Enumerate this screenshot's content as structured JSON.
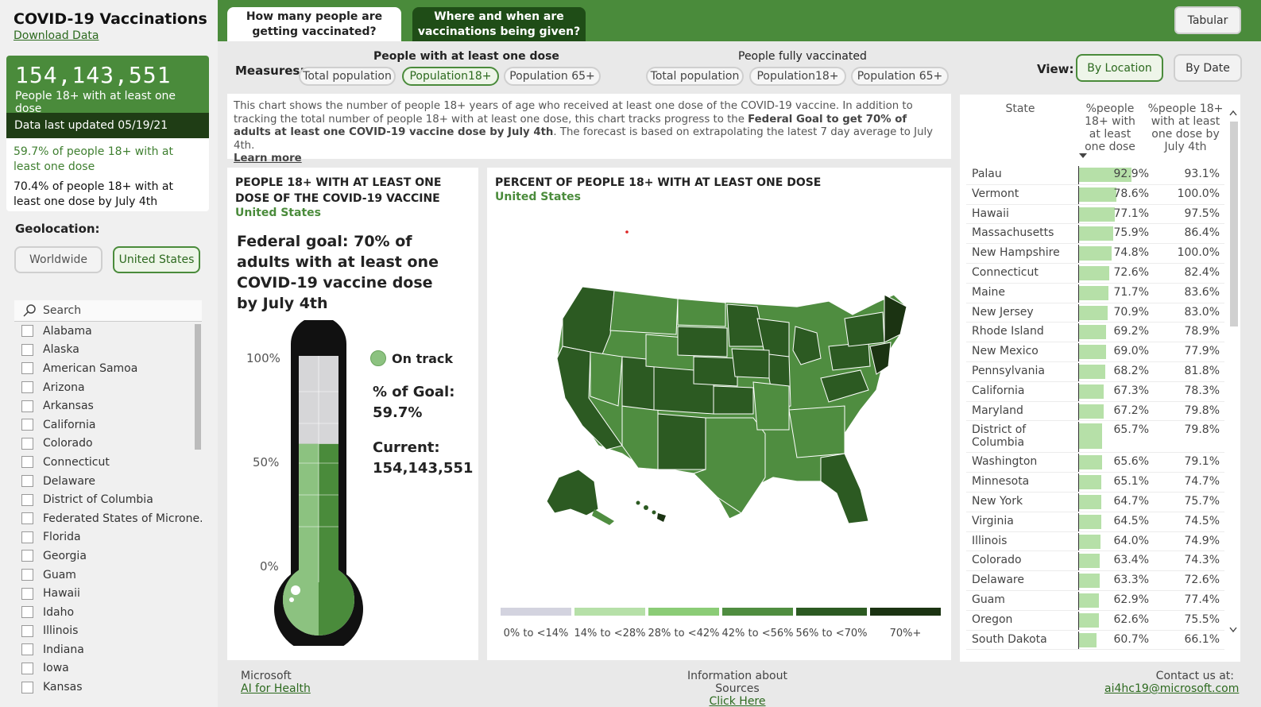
{
  "app": {
    "title": "COVID-19 Vaccinations",
    "download": "Download Data"
  },
  "kpi": {
    "number": "154,143,551",
    "label": "People 18+ with at least one dose",
    "updated": "Data last updated 05/19/21",
    "pct_text": "59.7% of people 18+ with at least one dose",
    "proj_text": "70.4% of people 18+ with at least one dose by July 4th"
  },
  "geolocation": {
    "label": "Geolocation:",
    "options": [
      "Worldwide",
      "United States"
    ],
    "selected": "United States"
  },
  "slicer": {
    "search_placeholder": "Search",
    "items": [
      "Alabama",
      "Alaska",
      "American Samoa",
      "Arizona",
      "Arkansas",
      "California",
      "Colorado",
      "Connecticut",
      "Delaware",
      "District of Columbia",
      "Federated States of Microne...",
      "Florida",
      "Georgia",
      "Guam",
      "Hawaii",
      "Idaho",
      "Illinois",
      "Indiana",
      "Iowa",
      "Kansas"
    ]
  },
  "tabs": [
    {
      "label": "How many people are getting vaccinated?",
      "active": true
    },
    {
      "label": "Where and when are vaccinations being given?",
      "active": false
    }
  ],
  "tabular_button": "Tabular",
  "measures": {
    "label": "Measures:",
    "group1_title": "People with at least one dose",
    "group2_title": "People fully vaccinated",
    "group1": [
      "Total population",
      "Population18+",
      "Population 65+"
    ],
    "group2": [
      "Total population",
      "Population18+",
      "Population 65+"
    ],
    "selected": "Population18+"
  },
  "view": {
    "label": "View:",
    "options": [
      "By Location",
      "By Date"
    ],
    "selected": "By Location"
  },
  "description": {
    "part1": "This chart shows the number of people 18+ years of age who received at least one dose of the COVID-19 vaccine. In addition to tracking the total number of people 18+ with at least one dose, this chart tracks progress to the ",
    "bold": "Federal Goal to get 70% of adults at least one COVID-19 vaccine dose by July 4th",
    "part2": ". The forecast is based on extrapolating the latest 7 day average to July 4th.",
    "link": "Learn more"
  },
  "thermo": {
    "title": "PEOPLE 18+ WITH AT LEAST ONE DOSE OF THE COVID-19 VACCINE",
    "subtitle": "United States",
    "goal_text": "Federal goal: 70% of adults with at least one COVID-19 vaccine dose by July 4th",
    "axis": [
      "100%",
      "50%",
      "0%"
    ],
    "status": "On track",
    "goal_label": "% of Goal:",
    "goal_value": "59.7%",
    "current_label": "Current:",
    "current_value": "154,143,551",
    "fill_fraction": 0.597
  },
  "map": {
    "title": "PERCENT OF PEOPLE 18+ WITH AT LEAST ONE DOSE",
    "subtitle": "United States",
    "legend": [
      {
        "label": "0% to <14%",
        "color": "#d3d3df"
      },
      {
        "label": "14% to <28%",
        "color": "#b6e0a8"
      },
      {
        "label": "28% to <42%",
        "color": "#8bcc76"
      },
      {
        "label": "42% to <56%",
        "color": "#4f8d40"
      },
      {
        "label": "56% to <70%",
        "color": "#2c5a22"
      },
      {
        "label": "70%+",
        "color": "#1b3312"
      }
    ]
  },
  "table": {
    "headers": [
      "State",
      "%people 18+ with at least one dose",
      "%people 18+ with at least one dose by July 4th"
    ],
    "rows": [
      {
        "state": "Palau",
        "pct": "92.9%",
        "proj": "93.1%",
        "v": 92.9
      },
      {
        "state": "Vermont",
        "pct": "78.6%",
        "proj": "100.0%",
        "v": 78.6
      },
      {
        "state": "Hawaii",
        "pct": "77.1%",
        "proj": "97.5%",
        "v": 77.1
      },
      {
        "state": "Massachusetts",
        "pct": "75.9%",
        "proj": "86.4%",
        "v": 75.9
      },
      {
        "state": "New Hampshire",
        "pct": "74.8%",
        "proj": "100.0%",
        "v": 74.8
      },
      {
        "state": "Connecticut",
        "pct": "72.6%",
        "proj": "82.4%",
        "v": 72.6
      },
      {
        "state": "Maine",
        "pct": "71.7%",
        "proj": "83.6%",
        "v": 71.7
      },
      {
        "state": "New Jersey",
        "pct": "70.9%",
        "proj": "83.0%",
        "v": 70.9
      },
      {
        "state": "Rhode Island",
        "pct": "69.2%",
        "proj": "78.9%",
        "v": 69.2
      },
      {
        "state": "New Mexico",
        "pct": "69.0%",
        "proj": "77.9%",
        "v": 69.0
      },
      {
        "state": "Pennsylvania",
        "pct": "68.2%",
        "proj": "81.8%",
        "v": 68.2
      },
      {
        "state": "California",
        "pct": "67.3%",
        "proj": "78.3%",
        "v": 67.3
      },
      {
        "state": "Maryland",
        "pct": "67.2%",
        "proj": "79.8%",
        "v": 67.2
      },
      {
        "state": "District of Columbia",
        "pct": "65.7%",
        "proj": "79.8%",
        "v": 65.7
      },
      {
        "state": "Washington",
        "pct": "65.6%",
        "proj": "79.1%",
        "v": 65.6
      },
      {
        "state": "Minnesota",
        "pct": "65.1%",
        "proj": "74.7%",
        "v": 65.1
      },
      {
        "state": "New York",
        "pct": "64.7%",
        "proj": "75.7%",
        "v": 64.7
      },
      {
        "state": "Virginia",
        "pct": "64.5%",
        "proj": "74.5%",
        "v": 64.5
      },
      {
        "state": "Illinois",
        "pct": "64.0%",
        "proj": "74.9%",
        "v": 64.0
      },
      {
        "state": "Colorado",
        "pct": "63.4%",
        "proj": "74.3%",
        "v": 63.4
      },
      {
        "state": "Delaware",
        "pct": "63.3%",
        "proj": "72.6%",
        "v": 63.3
      },
      {
        "state": "Guam",
        "pct": "62.9%",
        "proj": "77.4%",
        "v": 62.9
      },
      {
        "state": "Oregon",
        "pct": "62.6%",
        "proj": "75.5%",
        "v": 62.6
      },
      {
        "state": "South Dakota",
        "pct": "60.7%",
        "proj": "66.1%",
        "v": 60.7
      }
    ]
  },
  "footer": {
    "left_text": "Microsoft",
    "left_link": "AI for Health",
    "center_text": "Information about Sources",
    "center_link": "Click Here",
    "right_text": "Contact us at:",
    "right_link": "ai4hc19@microsoft.com"
  },
  "colors": {
    "brand": "#4a8b3b",
    "dark": "#1f3d15",
    "bar": "#b6e0a8"
  }
}
